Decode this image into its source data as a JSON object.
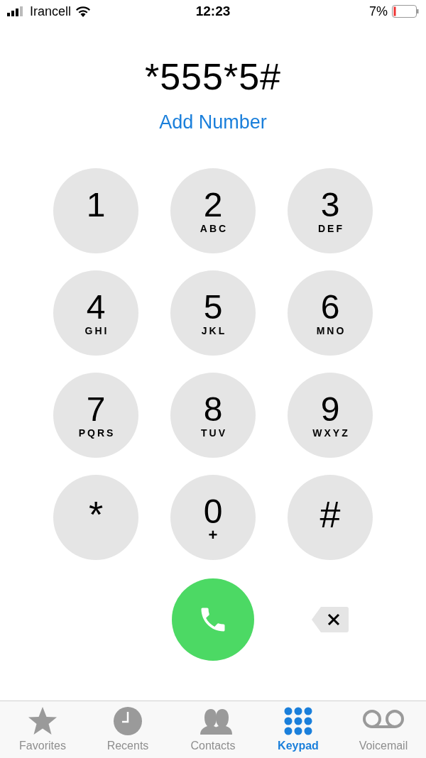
{
  "status_bar": {
    "carrier": "Irancell",
    "time": "12:23",
    "battery": "7%"
  },
  "dialed_number": "*555*5#",
  "add_number": "Add Number",
  "keys": [
    {
      "main": "1"
    },
    {
      "main": "2",
      "sub": "ABC"
    },
    {
      "main": "3",
      "sub": "DEF"
    },
    {
      "main": "4",
      "sub": "GHI"
    },
    {
      "main": "5",
      "sub": "JKL"
    },
    {
      "main": "6",
      "sub": "MNO"
    },
    {
      "main": "7",
      "sub": "PQRS"
    },
    {
      "main": "8",
      "sub": "TUV"
    },
    {
      "main": "9",
      "sub": "WXYZ"
    },
    {
      "main": "*",
      "kind": "symbol"
    },
    {
      "main": "0",
      "sub": "+",
      "kind": "plus"
    },
    {
      "main": "#",
      "kind": "symbol"
    }
  ],
  "tabs": [
    {
      "kind": "favorites",
      "label": "Favorites",
      "selected": false
    },
    {
      "kind": "recents",
      "label": "Recents",
      "selected": false
    },
    {
      "kind": "contacts",
      "label": "Contacts",
      "selected": false
    },
    {
      "kind": "keypad",
      "label": "Keypad",
      "selected": true
    },
    {
      "kind": "voicemail",
      "label": "Voicemail",
      "selected": false
    }
  ]
}
